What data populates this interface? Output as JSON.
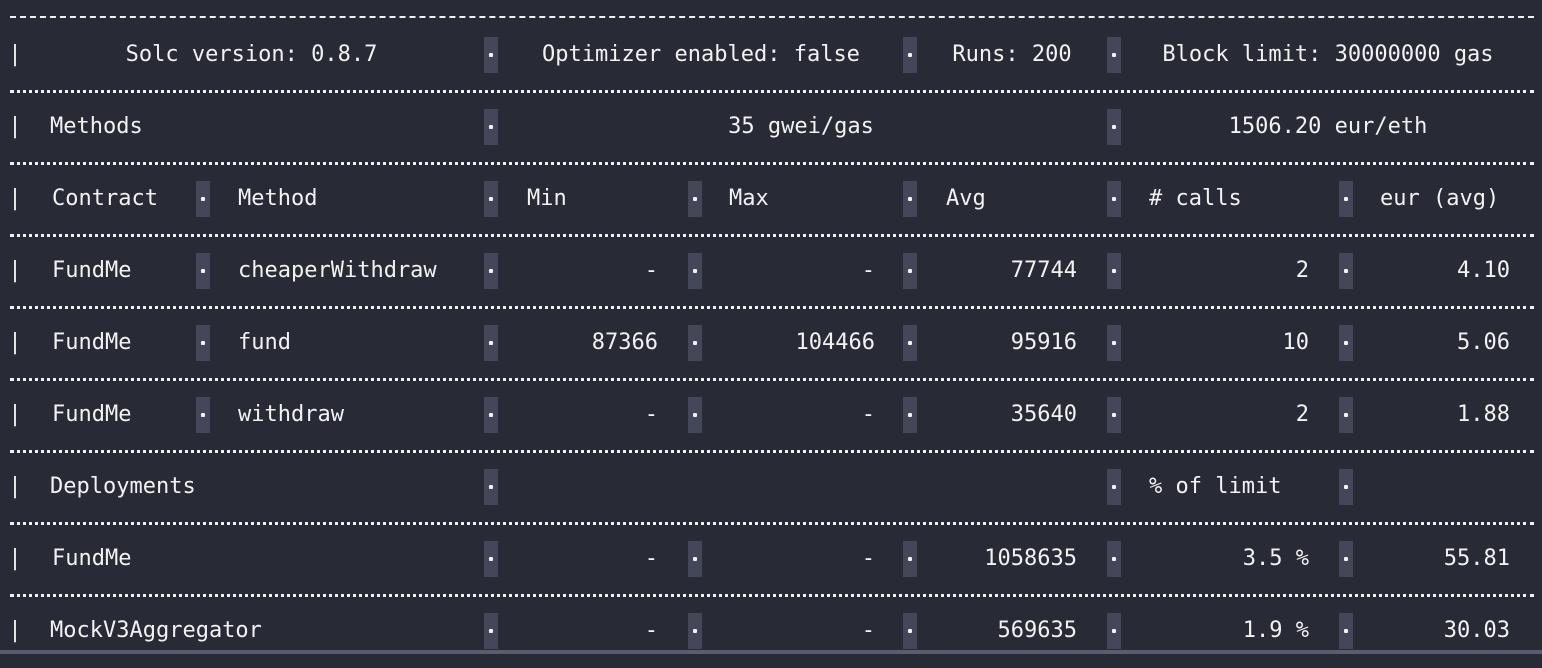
{
  "header": {
    "solc": "Solc version: 0.8.7",
    "optimizer": "Optimizer enabled: false",
    "runs": "Runs: 200",
    "block_limit": "Block limit: 30000000 gas"
  },
  "methods_section": {
    "label": "Methods",
    "gas_price": "35 gwei/gas",
    "eth_price": "1506.20 eur/eth"
  },
  "columns": {
    "contract": "Contract",
    "method": "Method",
    "min": "Min",
    "max": "Max",
    "avg": "Avg",
    "calls": "# calls",
    "eur_avg": "eur (avg)"
  },
  "method_rows": [
    {
      "contract": "FundMe",
      "method": "cheaperWithdraw",
      "min": "-",
      "max": "-",
      "avg": "77744",
      "calls": "2",
      "eur": "4.10"
    },
    {
      "contract": "FundMe",
      "method": "fund",
      "min": "87366",
      "max": "104466",
      "avg": "95916",
      "calls": "10",
      "eur": "5.06"
    },
    {
      "contract": "FundMe",
      "method": "withdraw",
      "min": "-",
      "max": "-",
      "avg": "35640",
      "calls": "2",
      "eur": "1.88"
    }
  ],
  "deployments_section": {
    "label": "Deployments",
    "limit_label": "% of limit"
  },
  "deployment_rows": [
    {
      "contract": "FundMe",
      "min": "-",
      "max": "-",
      "avg": "1058635",
      "pct": "3.5 %",
      "eur": "55.81"
    },
    {
      "contract": "MockV3Aggregator",
      "min": "-",
      "max": "-",
      "avg": "569635",
      "pct": "1.9 %",
      "eur": "30.03"
    }
  ]
}
